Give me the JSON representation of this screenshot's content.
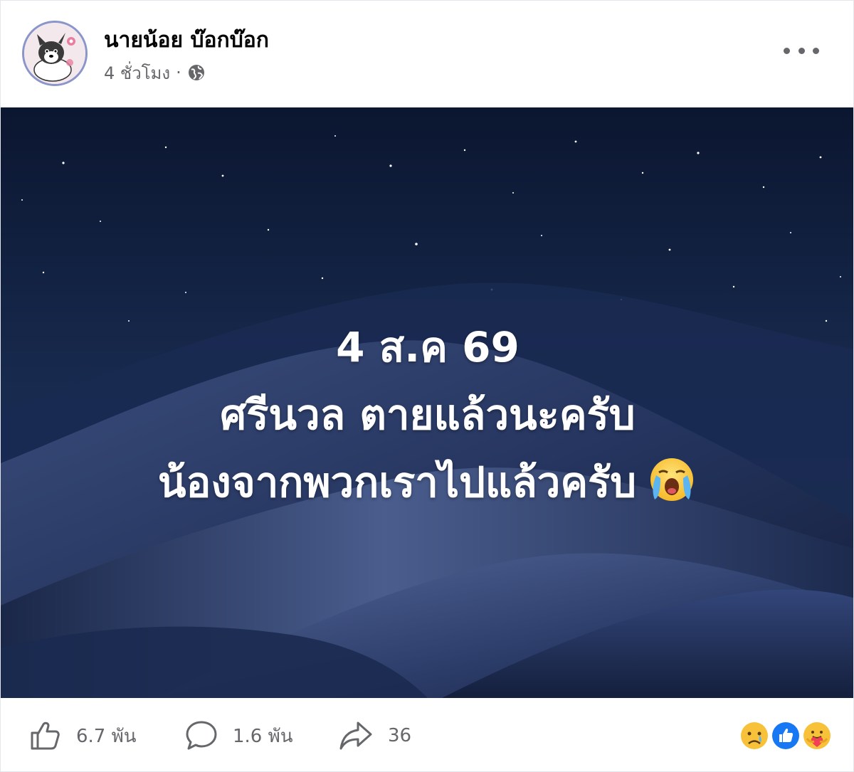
{
  "post": {
    "author_name": "นายน้อย บ๊อกบ๊อก",
    "timestamp": "4 ชั่วโมง",
    "separator": "·",
    "privacy_icon": "globe-icon",
    "menu_icon": "more-icon"
  },
  "image_text": {
    "line1": "4 ส.ค 69",
    "line2": "ศรีนวล ตายแล้วนะครับ",
    "line3": "น้องจากพวกเราไปแล้วครับ",
    "line3_emoji": "crying-face-emoji"
  },
  "footer": {
    "like_count": "6.7 พัน",
    "comment_count": "1.6 พัน",
    "share_count": "36",
    "reaction_icons": [
      "sad-reaction-icon",
      "like-reaction-icon",
      "care-reaction-icon"
    ]
  },
  "colors": {
    "text_primary": "#050505",
    "text_secondary": "#65676b",
    "like_blue": "#1877f2",
    "sky_dark": "#0f1a35",
    "dune": "#2a3a66"
  }
}
